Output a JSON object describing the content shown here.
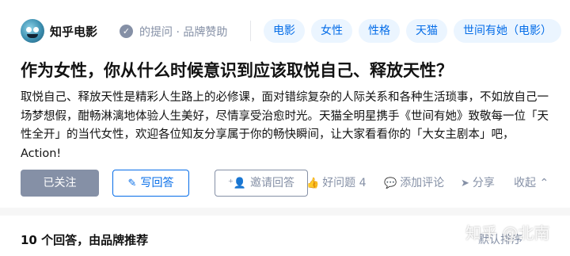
{
  "header": {
    "author": "知乎电影",
    "meta": "的提问 · 品牌赞助",
    "tags": [
      "电影",
      "女性",
      "性格",
      "天猫",
      "世间有她（电影）"
    ]
  },
  "question": {
    "title": "作为女性，你从什么时候意识到应该取悦自己、释放天性？",
    "description": "取悦自己、释放天性是精彩人生路上的必修课，面对错综复杂的人际关系和各种生活琐事，不如放自己一场梦想假，酣畅淋漓地体验人生美好，尽情享受治愈时光。天猫全明星携手《世间有她》致敬每一位「天性全开」的当代女性，欢迎各位知友分享属于你的畅快瞬间，让大家看看你的「大女主剧本」吧，Action!"
  },
  "actions": {
    "followed": "已关注",
    "write_answer": "写回答",
    "invite": "邀请回答",
    "good_question": "好问题 4",
    "add_comment": "添加评论",
    "share": "分享",
    "collapse": "收起"
  },
  "answers": {
    "title": "10 个回答，由品牌推荐",
    "sort": "默认排序"
  },
  "watermark": "知乎 @北南"
}
